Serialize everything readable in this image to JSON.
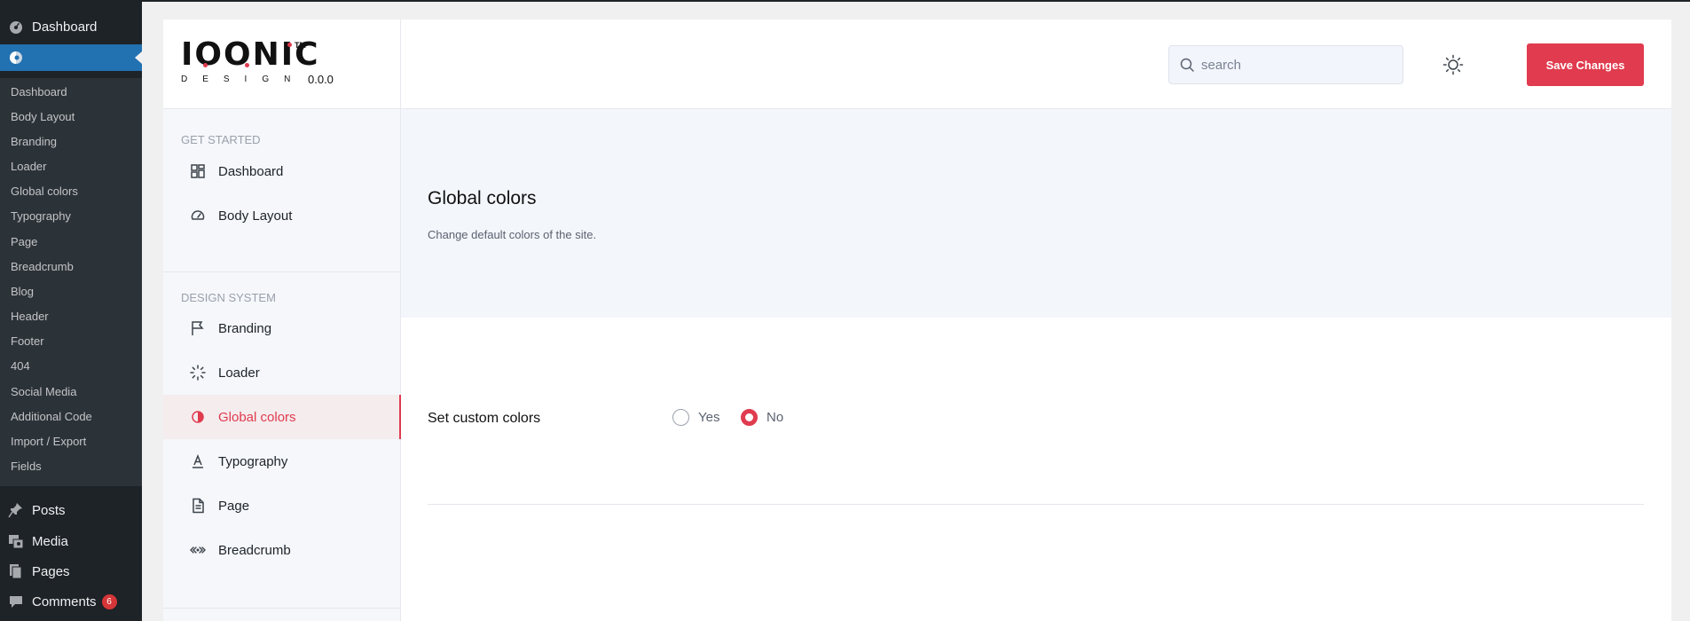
{
  "wp_sidebar": {
    "dashboard_label": "Dashboard",
    "submenu": [
      "Dashboard",
      "Body Layout",
      "Branding",
      "Loader",
      "Global colors",
      "Typography",
      "Page",
      "Breadcrumb",
      "Blog",
      "Header",
      "Footer",
      "404",
      "Social Media",
      "Additional Code",
      "Import / Export",
      "Fields"
    ],
    "main_items": [
      {
        "label": "Posts",
        "icon": "pin-icon"
      },
      {
        "label": "Media",
        "icon": "media-icon"
      },
      {
        "label": "Pages",
        "icon": "pages-icon"
      },
      {
        "label": "Comments",
        "icon": "comment-icon",
        "badge": "6"
      }
    ],
    "accent": "#2271b1",
    "badge_color": "#d63638"
  },
  "logo": {
    "wordmark": "IOONIC",
    "tm": "TM",
    "subline": "DESIGN",
    "version": "0.0.0"
  },
  "header": {
    "search_placeholder": "search",
    "save_label": "Save Changes",
    "accent": "#e03b4e"
  },
  "nav": {
    "group_get_started": "GET STARTED",
    "group_design_system": "DESIGN SYSTEM",
    "items": [
      {
        "label": "Dashboard",
        "icon": "grid-icon"
      },
      {
        "label": "Body Layout",
        "icon": "gauge-icon"
      },
      {
        "label": "Branding",
        "icon": "flag-icon"
      },
      {
        "label": "Loader",
        "icon": "spinner-icon"
      },
      {
        "label": "Global colors",
        "icon": "contrast-icon",
        "active": true
      },
      {
        "label": "Typography",
        "icon": "text-icon"
      },
      {
        "label": "Page",
        "icon": "document-icon"
      },
      {
        "label": "Breadcrumb",
        "icon": "breadcrumb-icon"
      }
    ]
  },
  "content": {
    "title": "Global colors",
    "description": "Change default colors of the site.",
    "setting_label": "Set custom colors",
    "options": [
      {
        "label": "Yes",
        "checked": false
      },
      {
        "label": "No",
        "checked": true
      }
    ]
  }
}
